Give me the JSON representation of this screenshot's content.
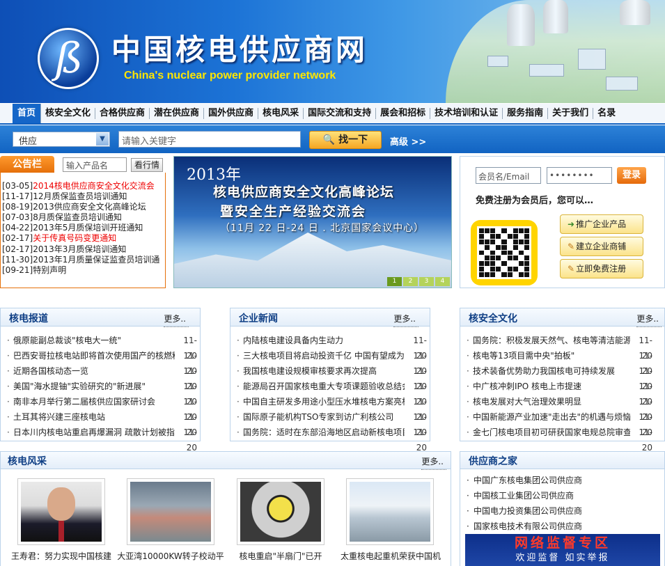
{
  "header": {
    "title": "中国核电供应商网",
    "subtitle": "China's nuclear power provider network"
  },
  "nav": {
    "items": [
      "首页",
      "核安全文化",
      "合格供应商",
      "潜在供应商",
      "国外供应商",
      "核电风采",
      "国际交流和支持",
      "展会和招标",
      "技术培训和认证",
      "服务指南",
      "关于我们",
      "名录"
    ]
  },
  "search": {
    "category": "供应",
    "placeholder": "请输入关键字",
    "button": "找一下",
    "advanced": "高级 >>"
  },
  "notice": {
    "tab": "公告栏",
    "product_placeholder": "输入产品名",
    "view_button": "看行情",
    "items": [
      {
        "date": "[03-05]",
        "text": "2014核电供应商安全文化交流会",
        "red": true
      },
      {
        "date": "[11-17]",
        "text": "12月质保监查员培训通知",
        "red": false
      },
      {
        "date": "[08-19]",
        "text": "2013供应商安全文化高峰论坛",
        "red": false
      },
      {
        "date": "[07-03]",
        "text": "8月质保监查员培训通知",
        "red": false
      },
      {
        "date": "[04-22]",
        "text": "2013年5月质保培训开班通知",
        "red": false
      },
      {
        "date": "[02-17]",
        "text": "关于传真号码变更通知",
        "red": true
      },
      {
        "date": "[02-17]",
        "text": "2013年3月质保培训通知",
        "red": false
      },
      {
        "date": "[11-30]",
        "text": "2013年1月质量保证监查员培训通",
        "red": false
      },
      {
        "date": "[09-21]",
        "text": "特别声明",
        "red": false
      }
    ]
  },
  "slide": {
    "year": "2013年",
    "line1": "核电供应商安全文化高峰论坛",
    "line2": "暨安全生产经验交流会",
    "line3": "（11月 22 日-24 日 . 北京国家会议中心）",
    "pages": [
      "1",
      "2",
      "3",
      "4"
    ]
  },
  "member": {
    "name_placeholder": "会员名/Email",
    "password_value": "••••••••",
    "login": "登录",
    "register_text": "免费注册为会员后，您可以…",
    "buttons": [
      "推广企业产品",
      "建立企业商铺",
      "立即免费注册"
    ]
  },
  "panels": [
    {
      "title": "核电报道",
      "more": "更多..",
      "rows": [
        {
          "t": "俄原能副总裁谈\"核电大一统\"",
          "d": "11-20"
        },
        {
          "t": "巴西安哥拉核电站即将首次使用国产的核燃料",
          "d": "11-20"
        },
        {
          "t": "近期各国核动态一览",
          "d": "11-20"
        },
        {
          "t": "美国\"海水提铀\"实验研究的\"新进展\"",
          "d": "11-20"
        },
        {
          "t": "南非本月举行第二届核供应国家研讨会",
          "d": "11-20"
        },
        {
          "t": "土耳其将兴建三座核电站",
          "d": "11-20"
        },
        {
          "t": "日本川内核电站重启再爆漏洞 疏散计划被指不",
          "d": "11-20"
        }
      ]
    },
    {
      "title": "企业新闻",
      "more": "更多..",
      "rows": [
        {
          "t": "内陆核电建设具备内生动力",
          "d": "11-20"
        },
        {
          "t": "三大核电项目将启动投资千亿 中国有望成为核",
          "d": "11-20"
        },
        {
          "t": "我国核电建设规模审核要求再次提高",
          "d": "11-20"
        },
        {
          "t": "能源局召开国家核电重大专项课题验收总结会",
          "d": "11-20"
        },
        {
          "t": "中国自主研发多用途小型压水堆核电方案亮相",
          "d": "11-20"
        },
        {
          "t": "国际原子能机构TSO专家到访广利核公司",
          "d": "11-20"
        },
        {
          "t": "国务院：适时在东部沿海地区启动新核电项目",
          "d": "11-20"
        }
      ]
    },
    {
      "title": "核安全文化",
      "more": "更多..",
      "rows": [
        {
          "t": "国务院：积极发展天然气、核电等清洁能源",
          "d": "11-20"
        },
        {
          "t": "核电等13项目需中央\"拍板\"",
          "d": "11-20"
        },
        {
          "t": "技术装备优势助力我国核电可持续发展",
          "d": "11-20"
        },
        {
          "t": "中广核冲刺IPO 核电上市提速",
          "d": "11-20"
        },
        {
          "t": "核电发展对大气治理效果明显",
          "d": "11-20"
        },
        {
          "t": "中国新能源产业加速\"走出去\"的机遇与烦恼",
          "d": "11-20"
        },
        {
          "t": "金七门核电项目初可研获国家电规总院审查",
          "d": "11-20"
        }
      ]
    }
  ],
  "photos": {
    "title": "核电风采",
    "more": "更多..",
    "items": [
      "王寿君：努力实现中国核建",
      "大亚湾10000KW转子校动平",
      "核电重启\"半扇门\"已开",
      "太重核电起重机荣获中国机"
    ]
  },
  "supplier": {
    "title": "供应商之家",
    "items": [
      "中国广东核电集团公司供应商",
      "中国核工业集团公司供应商",
      "中国电力投资集团公司供应商",
      "国家核电技术有限公司供应商"
    ]
  },
  "supervise": {
    "line1": "网络监督专区",
    "line2": "欢迎监督 如实举报"
  }
}
